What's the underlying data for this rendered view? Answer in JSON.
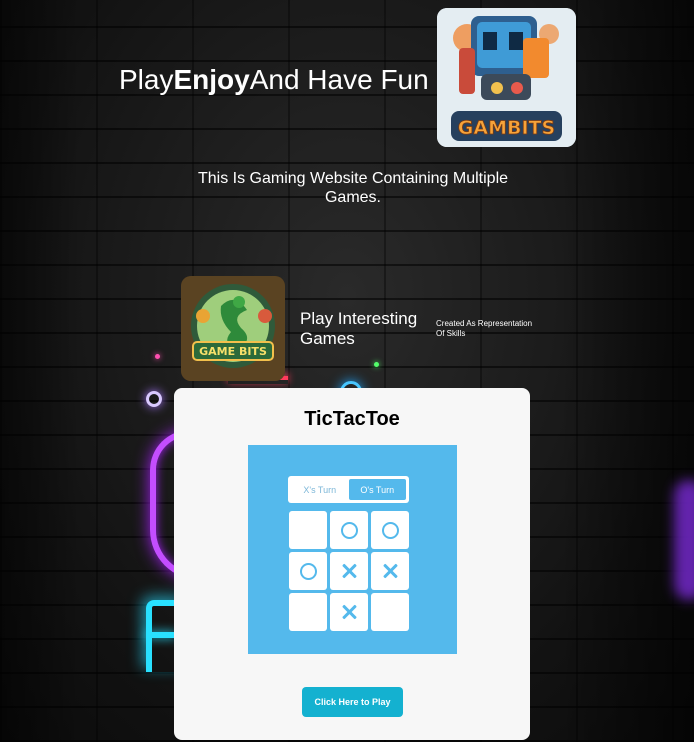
{
  "header": {
    "title_part1": "Play",
    "title_part2": "Enjoy",
    "title_part3": "And Have Fun",
    "brand_logo_text": "GAMBITS"
  },
  "intro": {
    "description": "This Is Gaming Website Containing Multiple Games."
  },
  "games_section": {
    "logo_text": "GAME BITS",
    "heading": "Play Interesting Games",
    "tagline": "Created As Representation Of Skills"
  },
  "game_card": {
    "title": "TicTacToe",
    "preview": {
      "x_turn_label": "X's Turn",
      "o_turn_label": "O's Turn",
      "active_turn": "O",
      "board": [
        [
          "",
          "O",
          "O"
        ],
        [
          "O",
          "X",
          "X"
        ],
        [
          "",
          "X",
          ""
        ]
      ]
    },
    "play_button_label": "Click Here to Play"
  },
  "colors": {
    "preview_bg": "#54b9ec",
    "button_bg": "#14b1d0",
    "card_bg": "#f7f7f7"
  }
}
